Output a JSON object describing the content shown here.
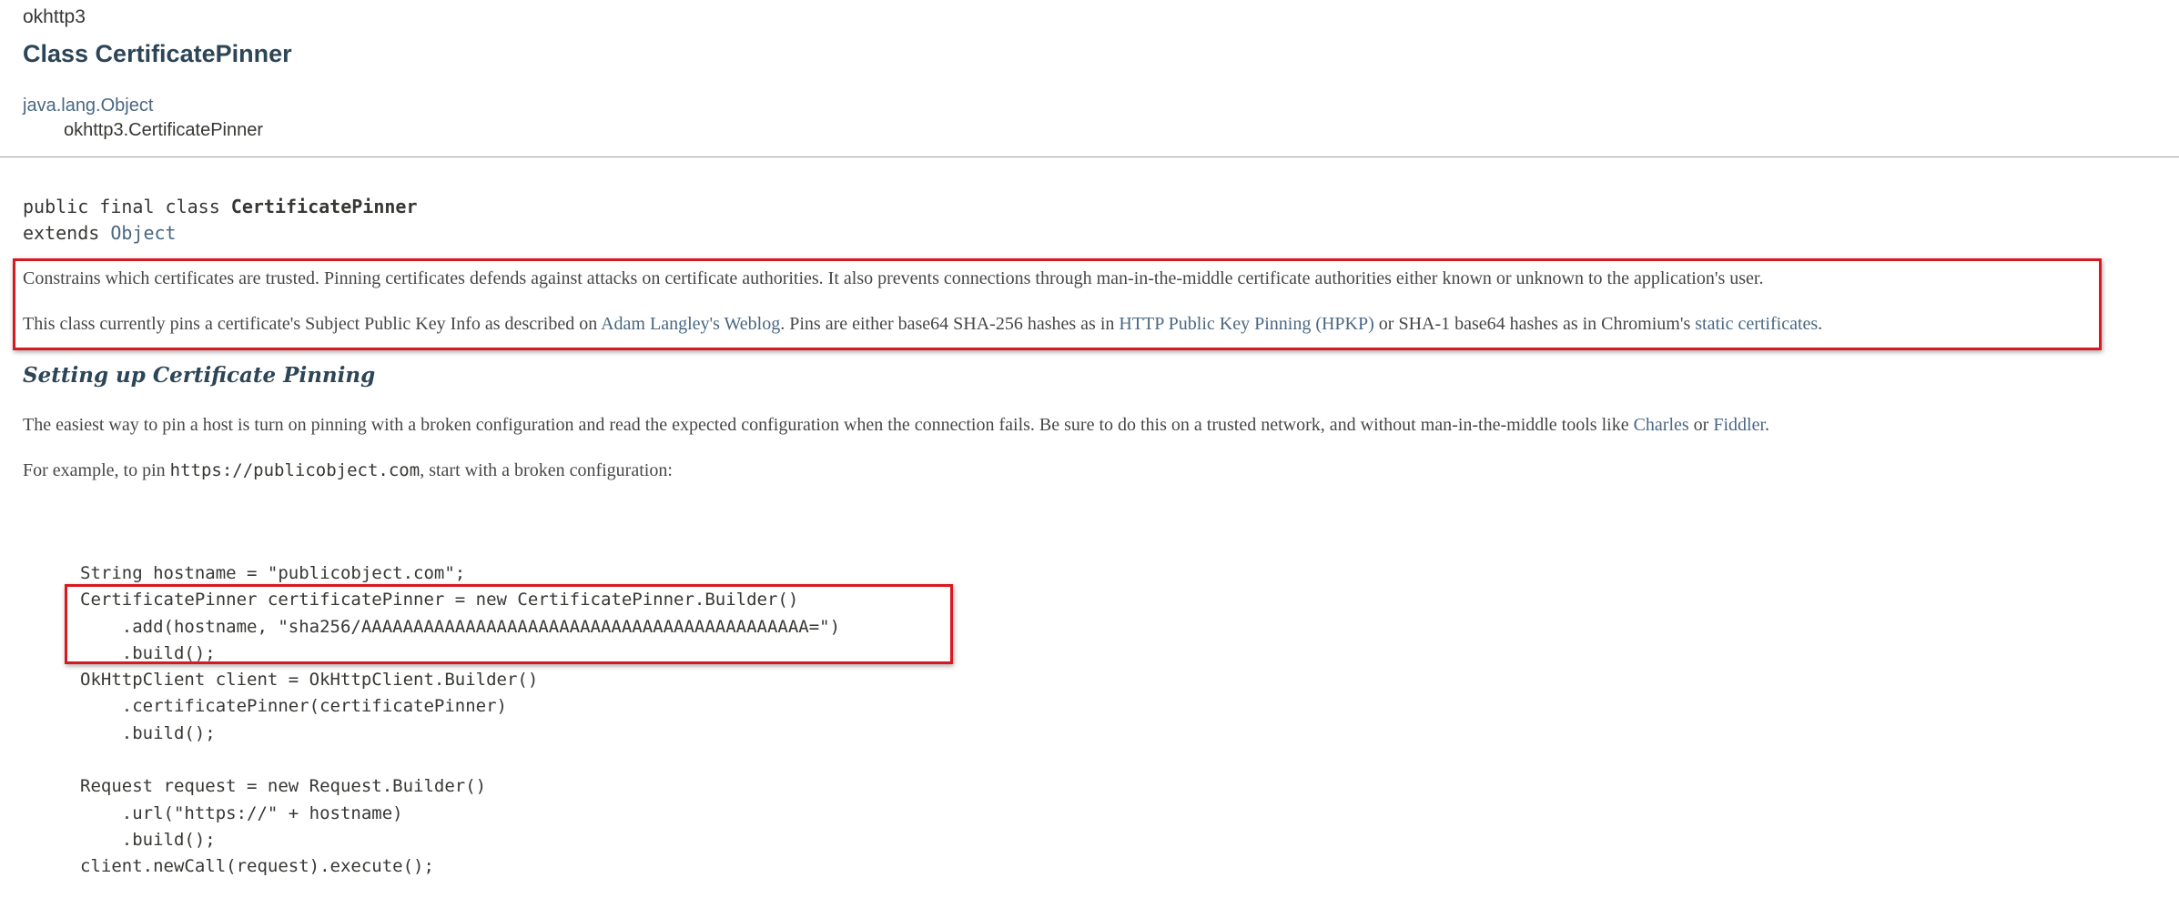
{
  "header": {
    "package": "okhttp3",
    "title": "Class CertificatePinner"
  },
  "inheritance": {
    "root": "java.lang.Object",
    "current": "okhttp3.CertificatePinner"
  },
  "signature": {
    "modifiers": "public final class ",
    "class_name": "CertificatePinner",
    "extends_keyword": "extends ",
    "superclass": "Object"
  },
  "description": {
    "p1": "Constrains which certificates are trusted. Pinning certificates defends against attacks on certificate authorities. It also prevents connections through man-in-the-middle certificate authorities either known or unknown to the application's user.",
    "p2_part1": "This class currently pins a certificate's Subject Public Key Info as described on ",
    "p2_link1": "Adam Langley's Weblog",
    "p2_part2": ". Pins are either base64 SHA-256 hashes as in ",
    "p2_link2": "HTTP Public Key Pinning (HPKP)",
    "p2_part3": " or SHA-1 base64 hashes as in Chromium's ",
    "p2_link3": "static certificates",
    "p2_part4": "."
  },
  "section": {
    "heading": "Setting up Certificate Pinning",
    "p3_part1": "The easiest way to pin a host is turn on pinning with a broken configuration and read the expected configuration when the connection fails. Be sure to do this on a trusted network, and without man-in-the-middle tools like ",
    "p3_link1": "Charles",
    "p3_part2": " or ",
    "p3_link2": "Fiddler",
    "p3_part3": ".",
    "p4_part1": "For example, to pin ",
    "p4_code": "https://publicobject.com",
    "p4_part2": ", start with a broken configuration:"
  },
  "code_lines": [
    "String hostname = \"publicobject.com\";",
    "CertificatePinner certificatePinner = new CertificatePinner.Builder()",
    "    .add(hostname, \"sha256/AAAAAAAAAAAAAAAAAAAAAAAAAAAAAAAAAAAAAAAAAAA=\")",
    "    .build();",
    "OkHttpClient client = OkHttpClient.Builder()",
    "    .certificatePinner(certificatePinner)",
    "    .build();",
    "",
    "Request request = new Request.Builder()",
    "    .url(\"https://\" + hostname)",
    "    .build();",
    "client.newCall(request).execute();"
  ],
  "colors": {
    "link": "#4a6782",
    "heading": "#2c4557",
    "highlight": "#d71920"
  }
}
